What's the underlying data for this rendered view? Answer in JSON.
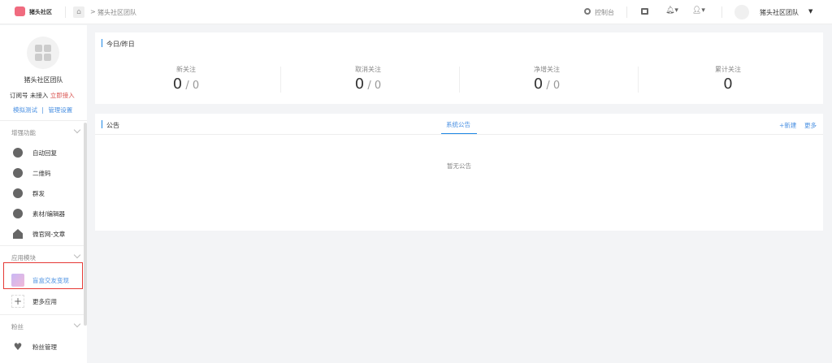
{
  "topbar": {
    "logo_text": "猪头社区",
    "breadcrumb": "猪头社区团队",
    "console": "控制台",
    "account_name": "猪头社区团队"
  },
  "sidebar": {
    "account_name": "猪头社区团队",
    "sub_type": "订阅号",
    "sub_status": "未接入",
    "connect_now": "立即接入",
    "link_test": "模拟测试",
    "link_sep": "|",
    "link_manage": "管理设置",
    "sections": [
      {
        "title": "增强功能",
        "items": [
          {
            "label": "自动回复",
            "icon": "chat-icon"
          },
          {
            "label": "二维码",
            "icon": "qrcode-icon"
          },
          {
            "label": "群发",
            "icon": "broadcast-icon"
          },
          {
            "label": "素材/编辑器",
            "icon": "edit-icon"
          },
          {
            "label": "微官网-文章",
            "icon": "home-icon"
          }
        ]
      },
      {
        "title": "应用模块",
        "items": [
          {
            "label": "盲盒交友变现",
            "icon": "blindbox-app-icon",
            "highlighted": true
          },
          {
            "label": "更多应用",
            "icon": "plus-icon"
          }
        ]
      },
      {
        "title": "粉丝",
        "items": [
          {
            "label": "粉丝管理",
            "icon": "heart-icon"
          }
        ]
      }
    ],
    "highlight_color": "#e53935"
  },
  "stats": {
    "title": "今日/昨日",
    "sep": "/",
    "items": [
      {
        "label": "新关注",
        "today": "0",
        "yesterday": "0"
      },
      {
        "label": "取消关注",
        "today": "0",
        "yesterday": "0"
      },
      {
        "label": "净增关注",
        "today": "0",
        "yesterday": "0"
      },
      {
        "label": "累计关注",
        "today": "0"
      }
    ]
  },
  "notice": {
    "title": "公告",
    "tab": "系统公告",
    "new": "+新建",
    "more": "更多",
    "empty": "暂无公告"
  },
  "colors": {
    "accent": "#1e88e5",
    "link": "#4a90e2",
    "danger": "#d9534f"
  }
}
